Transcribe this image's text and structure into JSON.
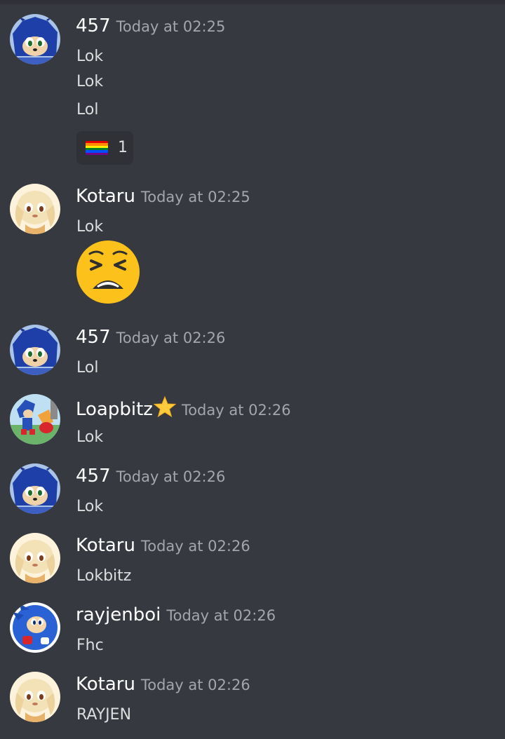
{
  "messages": [
    {
      "author": "457",
      "timestamp": "Today at 02:25",
      "avatar": "sonic-dark-avatar",
      "lines": [
        "Lok",
        "Lok",
        "Lol"
      ],
      "reaction": {
        "emoji": "rainbow-flag-icon",
        "count": "1"
      }
    },
    {
      "author": "Kotaru",
      "timestamp": "Today at 02:25",
      "avatar": "cream-character-avatar",
      "lines": [
        "Lok"
      ],
      "big_emoji": "weary-face-icon"
    },
    {
      "author": "457",
      "timestamp": "Today at 02:26",
      "avatar": "sonic-dark-avatar",
      "lines": [
        "Lol"
      ]
    },
    {
      "author": "Loapbitz",
      "author_badge": "star-icon",
      "timestamp": "Today at 02:26",
      "avatar": "sonic-tails-avatar",
      "lines": [
        "Lok"
      ]
    },
    {
      "author": "457",
      "timestamp": "Today at 02:26",
      "avatar": "sonic-dark-avatar",
      "lines": [
        "Lok"
      ]
    },
    {
      "author": "Kotaru",
      "timestamp": "Today at 02:26",
      "avatar": "cream-character-avatar",
      "lines": [
        "Lokbitz"
      ]
    },
    {
      "author": "rayjenboi",
      "timestamp": "Today at 02:26",
      "avatar": "sonic-classic-avatar",
      "lines": [
        "Fhc"
      ]
    },
    {
      "author": "Kotaru",
      "timestamp": "Today at 02:26",
      "avatar": "cream-character-avatar",
      "lines": [
        "RAYJEN"
      ]
    }
  ],
  "colors": {
    "background": "#36393f",
    "username": "#ffffff",
    "timestamp": "#a3a6aa",
    "text": "#dcddde",
    "reaction_bg": "#2f3136"
  }
}
